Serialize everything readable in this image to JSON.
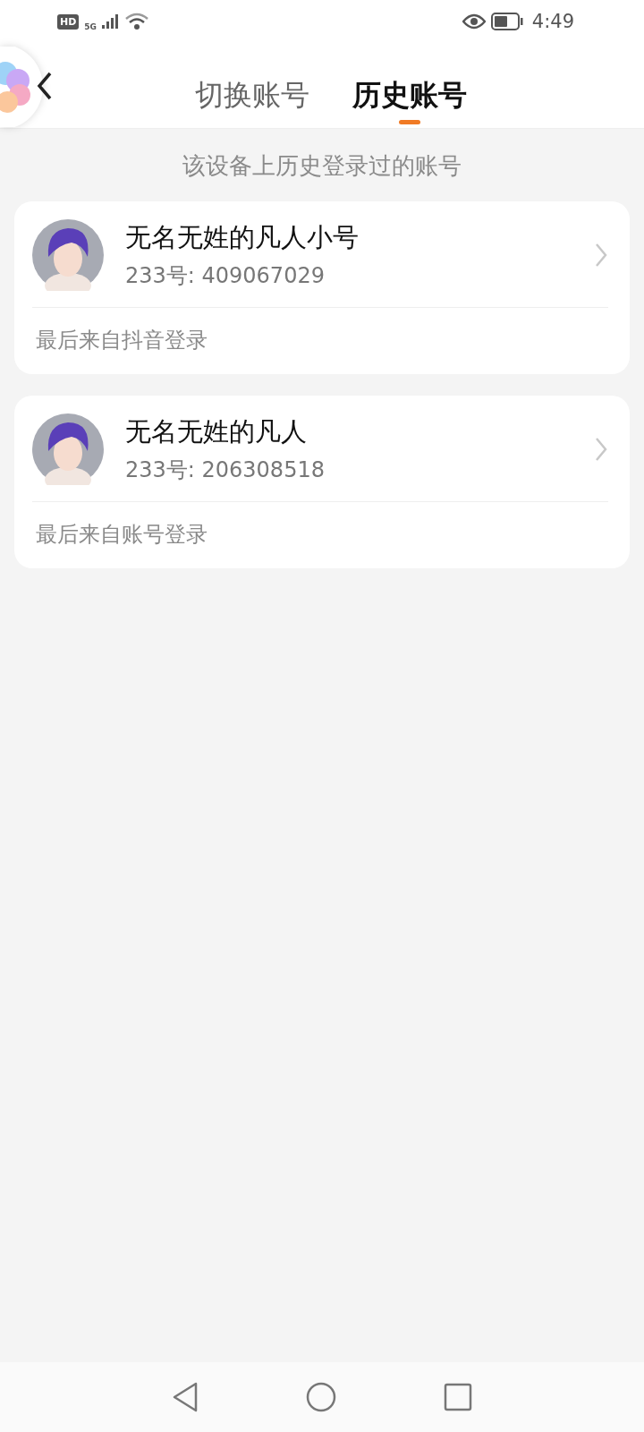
{
  "status_bar": {
    "hd": "HD",
    "network": "5G",
    "time": "4:49"
  },
  "tabs": [
    {
      "label": "切换账号",
      "selected": false
    },
    {
      "label": "历史账号",
      "selected": true
    }
  ],
  "subtitle": "该设备上历史登录过的账号",
  "accounts": [
    {
      "name": "无名无姓的凡人小号",
      "id": "233号: 409067029",
      "source": "最后来自抖音登录"
    },
    {
      "name": "无名无姓的凡人",
      "id": "233号: 206308518",
      "source": "最后来自账号登录"
    }
  ]
}
